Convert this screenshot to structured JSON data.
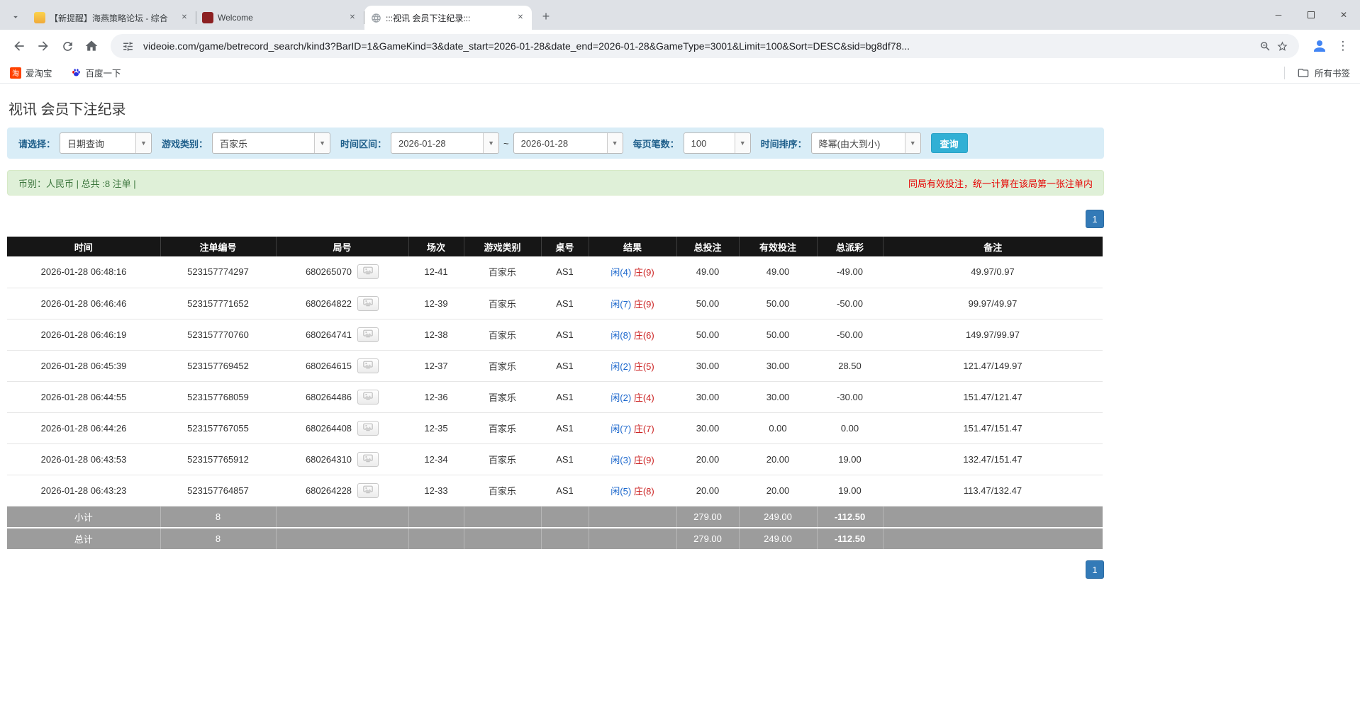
{
  "colors": {
    "accent_blue": "#337ab7",
    "search_button_cyan": "#31b0d5",
    "negative_red": "#e00000",
    "player_blue": "#1a66cc",
    "banker_red": "#cc2222",
    "table_header_bg": "#161616",
    "filter_bar_bg": "#d9edf7",
    "info_bar_bg": "#dff0d8"
  },
  "browser": {
    "tabs": [
      {
        "title": "【新提醒】海燕策略论坛 - 综合"
      },
      {
        "title": "Welcome"
      },
      {
        "title": ":::视讯 会员下注纪录:::"
      }
    ],
    "url": "videoie.com/game/betrecord_search/kind3?BarID=1&GameKind=3&date_start=2026-01-28&date_end=2026-01-28&GameType=3001&Limit=100&Sort=DESC&sid=bg8df78...",
    "bookmarks": [
      {
        "label": "爱淘宝"
      },
      {
        "label": "百度一下"
      }
    ],
    "all_bookmarks": "所有书签"
  },
  "page": {
    "title": "视讯 会员下注纪录",
    "filters": {
      "select_label": "请选择：",
      "select_value": "日期查询",
      "game_type_label": "游戏类别：",
      "game_type_value": "百家乐",
      "date_range_label": "时间区间：",
      "date_start": "2026-01-28",
      "date_separator": "~",
      "date_end": "2026-01-28",
      "page_size_label": "每页笔数：",
      "page_size_value": "100",
      "sort_label": "时间排序：",
      "sort_value": "降幂(由大到小)",
      "search_button": "查询"
    },
    "info_bar": {
      "left": "币别：人民币 | 总共 :8 注单 |",
      "right": "同局有效投注，统一计算在该局第一张注单内"
    },
    "pagination": {
      "label": "1"
    },
    "table": {
      "headers": [
        "时间",
        "注单编号",
        "局号",
        "场次",
        "游戏类别",
        "桌号",
        "结果",
        "总投注",
        "有效投注",
        "总派彩",
        "备注"
      ],
      "rows": [
        {
          "time": "2026-01-28 06:48:16",
          "bet_id": "523157774297",
          "round_id": "680265070",
          "session": "12-41",
          "game": "百家乐",
          "table_no": "AS1",
          "player": "闲(4)",
          "banker": "庄(9)",
          "total_bet": "49.00",
          "valid_bet": "49.00",
          "payout": "-49.00",
          "remark": "49.97/0.97"
        },
        {
          "time": "2026-01-28 06:46:46",
          "bet_id": "523157771652",
          "round_id": "680264822",
          "session": "12-39",
          "game": "百家乐",
          "table_no": "AS1",
          "player": "闲(7)",
          "banker": "庄(9)",
          "total_bet": "50.00",
          "valid_bet": "50.00",
          "payout": "-50.00",
          "remark": "99.97/49.97"
        },
        {
          "time": "2026-01-28 06:46:19",
          "bet_id": "523157770760",
          "round_id": "680264741",
          "session": "12-38",
          "game": "百家乐",
          "table_no": "AS1",
          "player": "闲(8)",
          "banker": "庄(6)",
          "total_bet": "50.00",
          "valid_bet": "50.00",
          "payout": "-50.00",
          "remark": "149.97/99.97"
        },
        {
          "time": "2026-01-28 06:45:39",
          "bet_id": "523157769452",
          "round_id": "680264615",
          "session": "12-37",
          "game": "百家乐",
          "table_no": "AS1",
          "player": "闲(2)",
          "banker": "庄(5)",
          "total_bet": "30.00",
          "valid_bet": "30.00",
          "payout": "28.50",
          "remark": "121.47/149.97"
        },
        {
          "time": "2026-01-28 06:44:55",
          "bet_id": "523157768059",
          "round_id": "680264486",
          "session": "12-36",
          "game": "百家乐",
          "table_no": "AS1",
          "player": "闲(2)",
          "banker": "庄(4)",
          "total_bet": "30.00",
          "valid_bet": "30.00",
          "payout": "-30.00",
          "remark": "151.47/121.47"
        },
        {
          "time": "2026-01-28 06:44:26",
          "bet_id": "523157767055",
          "round_id": "680264408",
          "session": "12-35",
          "game": "百家乐",
          "table_no": "AS1",
          "player": "闲(7)",
          "banker": "庄(7)",
          "total_bet": "30.00",
          "valid_bet": "0.00",
          "payout": "0.00",
          "remark": "151.47/151.47"
        },
        {
          "time": "2026-01-28 06:43:53",
          "bet_id": "523157765912",
          "round_id": "680264310",
          "session": "12-34",
          "game": "百家乐",
          "table_no": "AS1",
          "player": "闲(3)",
          "banker": "庄(9)",
          "total_bet": "20.00",
          "valid_bet": "20.00",
          "payout": "19.00",
          "remark": "132.47/151.47"
        },
        {
          "time": "2026-01-28 06:43:23",
          "bet_id": "523157764857",
          "round_id": "680264228",
          "session": "12-33",
          "game": "百家乐",
          "table_no": "AS1",
          "player": "闲(5)",
          "banker": "庄(8)",
          "total_bet": "20.00",
          "valid_bet": "20.00",
          "payout": "19.00",
          "remark": "113.47/132.47"
        }
      ],
      "subtotal": {
        "label": "小计",
        "count": "8",
        "total_bet": "279.00",
        "valid_bet": "249.00",
        "payout": "-112.50"
      },
      "total": {
        "label": "总计",
        "count": "8",
        "total_bet": "279.00",
        "valid_bet": "249.00",
        "payout": "-112.50"
      }
    }
  }
}
